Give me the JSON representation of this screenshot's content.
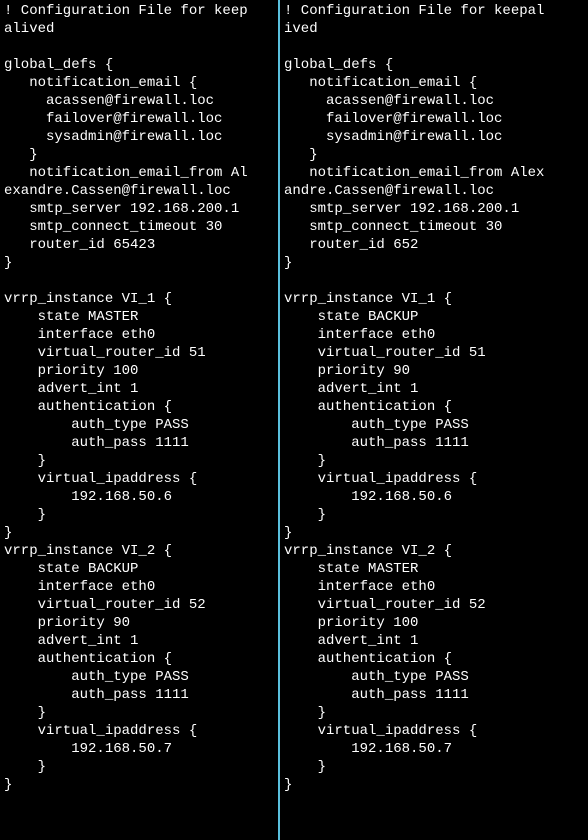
{
  "left_pane": {
    "lines": [
      "! Configuration File for keep",
      "alived",
      "",
      "global_defs {",
      "   notification_email {",
      "     acassen@firewall.loc",
      "     failover@firewall.loc",
      "     sysadmin@firewall.loc",
      "   }",
      "   notification_email_from Al",
      "exandre.Cassen@firewall.loc",
      "   smtp_server 192.168.200.1",
      "   smtp_connect_timeout 30",
      "   router_id 65423",
      "}",
      "",
      "vrrp_instance VI_1 {",
      "    state MASTER",
      "    interface eth0",
      "    virtual_router_id 51",
      "    priority 100",
      "    advert_int 1",
      "    authentication {",
      "        auth_type PASS",
      "        auth_pass 1111",
      "    }",
      "    virtual_ipaddress {",
      "        192.168.50.6",
      "    }",
      "}",
      "vrrp_instance VI_2 {",
      "    state BACKUP",
      "    interface eth0",
      "    virtual_router_id 52",
      "    priority 90",
      "    advert_int 1",
      "    authentication {",
      "        auth_type PASS",
      "        auth_pass 1111",
      "    }",
      "    virtual_ipaddress {",
      "        192.168.50.7",
      "    }",
      "}"
    ]
  },
  "right_pane": {
    "lines": [
      "! Configuration File for keepal",
      "ived",
      "",
      "global_defs {",
      "   notification_email {",
      "     acassen@firewall.loc",
      "     failover@firewall.loc",
      "     sysadmin@firewall.loc",
      "   }",
      "   notification_email_from Alex",
      "andre.Cassen@firewall.loc",
      "   smtp_server 192.168.200.1",
      "   smtp_connect_timeout 30",
      "   router_id 652",
      "}",
      "",
      "vrrp_instance VI_1 {",
      "    state BACKUP",
      "    interface eth0",
      "    virtual_router_id 51",
      "    priority 90",
      "    advert_int 1",
      "    authentication {",
      "        auth_type PASS",
      "        auth_pass 1111",
      "    }",
      "    virtual_ipaddress {",
      "        192.168.50.6",
      "    }",
      "}",
      "vrrp_instance VI_2 {",
      "    state MASTER",
      "    interface eth0",
      "    virtual_router_id 52",
      "    priority 100",
      "    advert_int 1",
      "    authentication {",
      "        auth_type PASS",
      "        auth_pass 1111",
      "    }",
      "    virtual_ipaddress {",
      "        192.168.50.7",
      "    }",
      "}"
    ]
  }
}
